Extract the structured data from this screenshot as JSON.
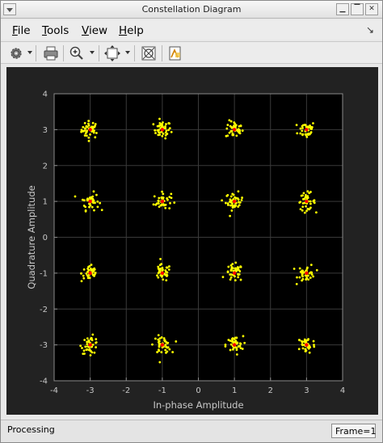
{
  "window": {
    "title": "Constellation Diagram"
  },
  "menu": [
    {
      "label": "File",
      "accel": "F",
      "rest": "ile"
    },
    {
      "label": "Tools",
      "accel": "T",
      "rest": "ools"
    },
    {
      "label": "View",
      "accel": "V",
      "rest": "iew"
    },
    {
      "label": "Help",
      "accel": "H",
      "rest": "elp"
    }
  ],
  "toolbar_icons": [
    "settings-gear-icon",
    "print-icon",
    "zoom-in-icon",
    "scale-axes-icon",
    "reference-constellation-icon",
    "measurements-icon"
  ],
  "colors": {
    "figure_bg": "#222222",
    "axes_bg": "#000000",
    "grid": "#3a3a3a",
    "axis_text": "#c8c8c8",
    "points": "#ffff00",
    "reference": "#ff0000"
  },
  "chart_data": {
    "type": "scatter",
    "title": "",
    "xlabel": "In-phase Amplitude",
    "ylabel": "Quadrature Amplitude",
    "xlim": [
      -4,
      4
    ],
    "ylim": [
      -4,
      4
    ],
    "xticks": [
      -4,
      -3,
      -2,
      -1,
      0,
      1,
      2,
      3,
      4
    ],
    "yticks": [
      -4,
      -3,
      -2,
      -1,
      0,
      1,
      2,
      3,
      4
    ],
    "grid": true,
    "series": [
      {
        "name": "",
        "color": "#ffff00",
        "points_per_symbol": 40,
        "noise_std": 0.12
      },
      {
        "name": "",
        "color": "#ff0000",
        "reference": true
      }
    ],
    "reference_constellation": [
      [
        -3,
        3
      ],
      [
        -1,
        3
      ],
      [
        1,
        3
      ],
      [
        3,
        3
      ],
      [
        -3,
        1
      ],
      [
        -1,
        1
      ],
      [
        1,
        1
      ],
      [
        3,
        1
      ],
      [
        -3,
        -1
      ],
      [
        -1,
        -1
      ],
      [
        1,
        -1
      ],
      [
        3,
        -1
      ],
      [
        -3,
        -3
      ],
      [
        -1,
        -3
      ],
      [
        1,
        -3
      ],
      [
        3,
        -3
      ]
    ]
  },
  "status": {
    "text": "Processing",
    "frame": "Frame=1"
  }
}
